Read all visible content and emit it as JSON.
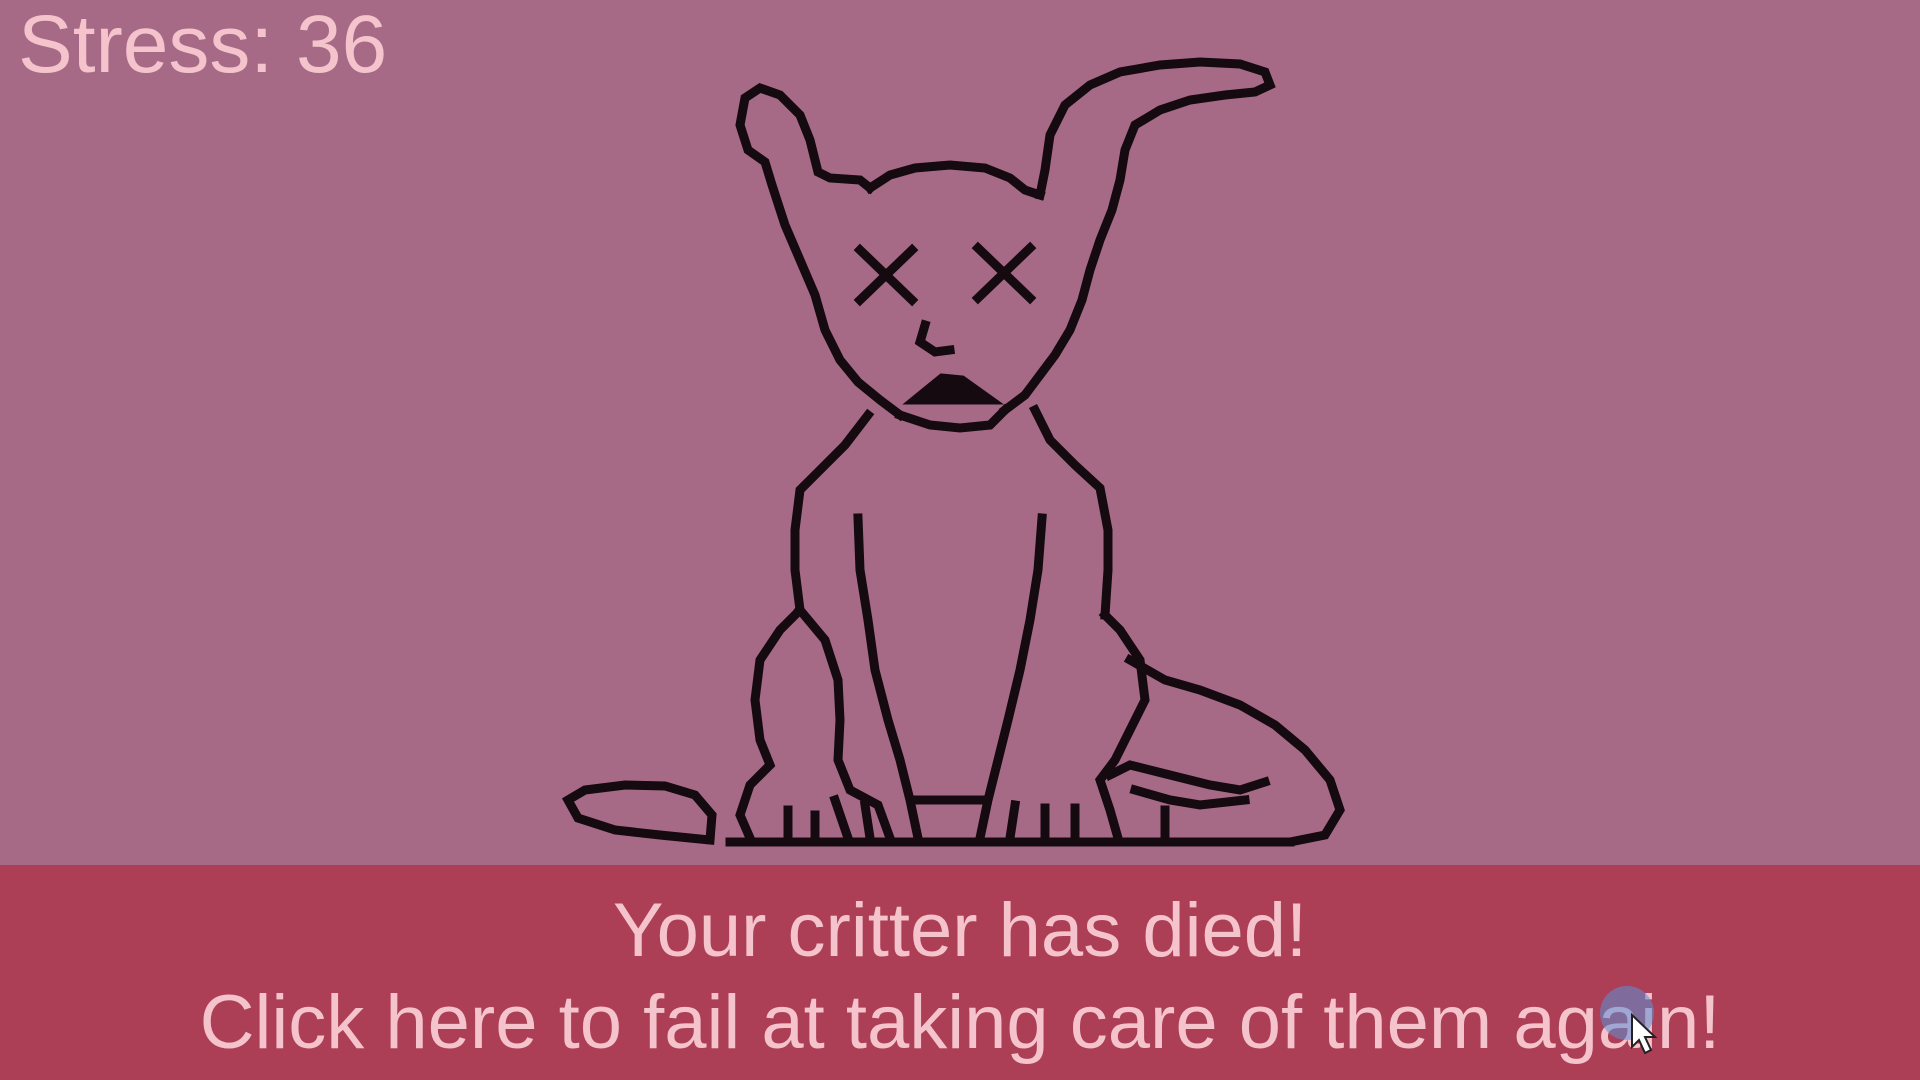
{
  "hud": {
    "stress_label": "Stress:",
    "stress_value": "36"
  },
  "critter": {
    "state": "dead",
    "eyes_icon": "x-eyes-icon"
  },
  "banner": {
    "line1": "Your critter has died!",
    "line2": "Click here to fail at taking care of them again!"
  },
  "colors": {
    "background": "#a66a87",
    "banner": "#ac3f55",
    "text": "#f4c3cc",
    "outline": "#140a10"
  }
}
